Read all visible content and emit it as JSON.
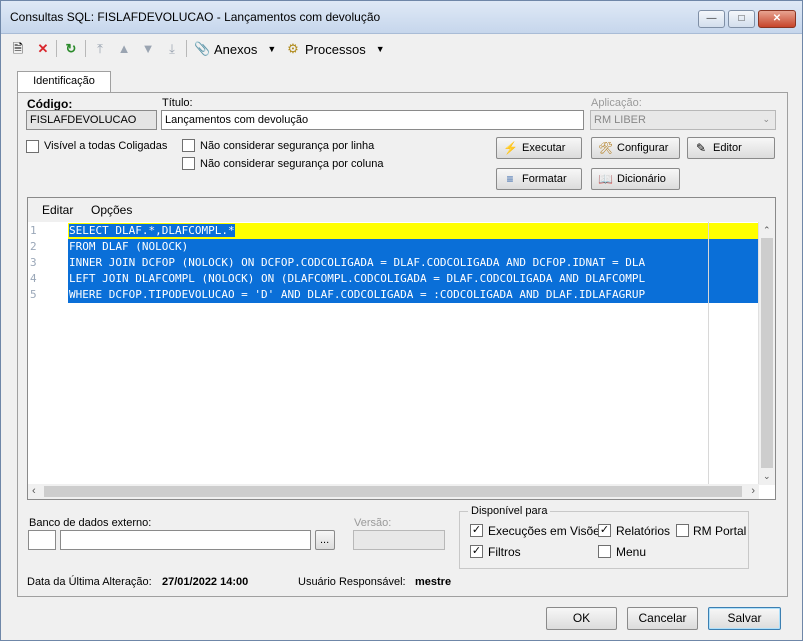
{
  "window": {
    "title": "Consultas SQL: FISLAFDEVOLUCAO - Lançamentos com devolução"
  },
  "toolbar": {
    "anexos": "Anexos",
    "processos": "Processos"
  },
  "tab": {
    "label": "Identificação"
  },
  "form": {
    "codigo_label": "Código:",
    "codigo_value": "FISLAFDEVOLUCAO",
    "titulo_label": "Título:",
    "titulo_value": "Lançamentos com devolução",
    "aplicacao_label": "Aplicação:",
    "aplicacao_value": "RM LIBER",
    "visivel_label": "Visível a todas Coligadas",
    "nao_linha_label": "Não considerar segurança por linha",
    "nao_coluna_label": "Não considerar segurança por coluna"
  },
  "buttons": {
    "executar": "Executar",
    "configurar": "Configurar",
    "editor": "Editor",
    "formatar": "Formatar",
    "dicionario": "Dicionário"
  },
  "editor": {
    "menu": [
      "Editar",
      "Opções"
    ],
    "line_numbers": [
      "1",
      "2",
      "3",
      "4",
      "5"
    ],
    "lines": [
      "SELECT DLAF.*,DLAFCOMPL.*",
      "FROM DLAF (NOLOCK)",
      "INNER JOIN DCFOP (NOLOCK) ON DCFOP.CODCOLIGADA = DLAF.CODCOLIGADA AND DCFOP.IDNAT = DLA",
      "LEFT JOIN DLAFCOMPL (NOLOCK) ON (DLAFCOMPL.CODCOLIGADA = DLAF.CODCOLIGADA AND DLAFCOMPL",
      "WHERE DCFOP.TIPODEVOLUCAO = 'D' AND DLAF.CODCOLIGADA = :CODCOLIGADA AND DLAF.IDLAFAGRUP"
    ],
    "highlight_color": "#ffff00",
    "selection_color": "#0a6fd8"
  },
  "bottom": {
    "banco_label": "Banco de dados externo:",
    "browse_label": "...",
    "versao_label": "Versão:",
    "disponivel_label": "Disponível para",
    "exec_visoes": "Execuções em Visões",
    "relatorios": "Relatórios",
    "rm_portal": "RM Portal",
    "filtros": "Filtros",
    "menu": "Menu"
  },
  "status": {
    "data_label": "Data da Última Alteração:",
    "data_value": "27/01/2022 14:00",
    "usuario_label": "Usuário Responsável:",
    "usuario_value": "mestre"
  },
  "footer": {
    "ok": "OK",
    "cancelar": "Cancelar",
    "salvar": "Salvar"
  }
}
